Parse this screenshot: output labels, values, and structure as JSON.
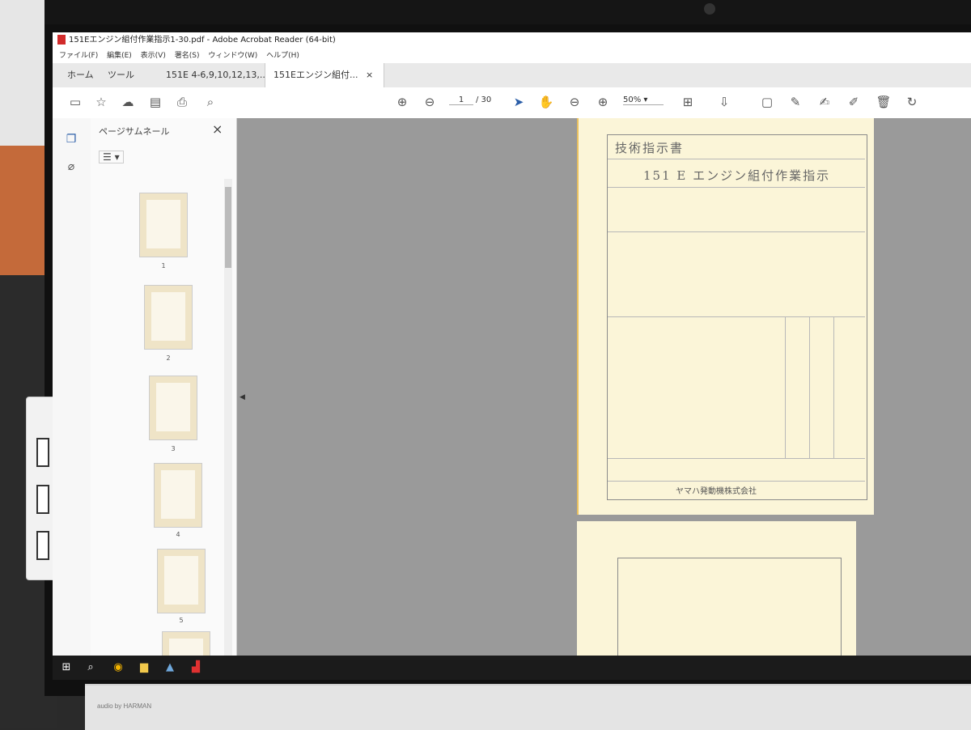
{
  "window": {
    "title": "151Eエンジン組付作業指示1-30.pdf - Adobe Acrobat Reader (64-bit)"
  },
  "menu": [
    "ファイル(F)",
    "編集(E)",
    "表示(V)",
    "署名(S)",
    "ウィンドウ(W)",
    "ヘルプ(H)"
  ],
  "tabs": {
    "home": "ホーム",
    "tools": "ツール",
    "doc1": "151E 4-6,9,10,12,13,...",
    "doc2": "151Eエンジン組付...",
    "doc2_close": "×"
  },
  "toolbar": {
    "current_page": "1",
    "total_pages": "/ 30",
    "zoom": "50%",
    "icons": [
      "save-icon",
      "star-icon",
      "cloud-upload-icon",
      "document-lock-icon",
      "print-icon",
      "search-icon",
      "page-up-icon",
      "page-down-icon",
      "select-cursor-icon",
      "hand-icon",
      "zoom-out-icon",
      "zoom-in-icon",
      "fit-page-icon",
      "scroll-mode-icon",
      "comment-icon",
      "pen-icon",
      "sign-icon",
      "edit-icon",
      "delete-icon",
      "rotate-icon"
    ]
  },
  "sidebar": {
    "title": "ページサムネール",
    "close": "×",
    "thumbnails": [
      "1",
      "2",
      "3",
      "4",
      "5"
    ]
  },
  "document": {
    "header": "技術指示書",
    "title": "151 E エンジン組付作業指示",
    "company": "ヤマハ発動機株式会社"
  },
  "monitor": {
    "brand": "audio by HARMAN"
  }
}
